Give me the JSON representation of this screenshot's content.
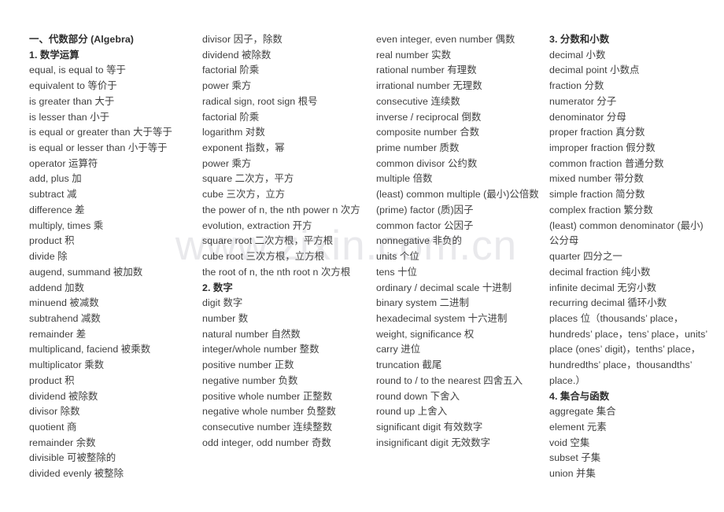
{
  "document": {
    "watermark": "www.zixin.com.cn",
    "background_color": "#ffffff",
    "text_color": "#3f3f3f",
    "watermark_color": "#e9e9ec"
  },
  "columns": [
    {
      "name": "column-1",
      "entries": [
        {
          "text": "一、代数部分 (Algebra)",
          "heading": true
        },
        {
          "text": "1. 数学运算",
          "heading": true
        },
        {
          "text": "equal, is equal to 等于",
          "heading": false
        },
        {
          "text": "equivalent to 等价于",
          "heading": false
        },
        {
          "text": "is greater than 大于",
          "heading": false
        },
        {
          "text": "is lesser than 小于",
          "heading": false
        },
        {
          "text": "is equal or greater than 大于等于",
          "heading": false
        },
        {
          "text": "is equal or lesser than 小于等于",
          "heading": false
        },
        {
          "text": "operator 运算符",
          "heading": false
        },
        {
          "text": "add, plus 加",
          "heading": false
        },
        {
          "text": "subtract 减",
          "heading": false
        },
        {
          "text": "difference 差",
          "heading": false
        },
        {
          "text": "multiply, times 乘",
          "heading": false
        },
        {
          "text": "product 积",
          "heading": false
        },
        {
          "text": "divide 除",
          "heading": false
        },
        {
          "text": "augend, summand 被加数",
          "heading": false
        },
        {
          "text": "addend 加数",
          "heading": false
        },
        {
          "text": "minuend 被减数",
          "heading": false
        },
        {
          "text": "subtrahend 减数",
          "heading": false
        },
        {
          "text": "remainder 差",
          "heading": false
        },
        {
          "text": "multiplicand, faciend 被乘数",
          "heading": false
        },
        {
          "text": "multiplicator 乘数",
          "heading": false
        },
        {
          "text": "product 积",
          "heading": false
        },
        {
          "text": "dividend 被除数",
          "heading": false
        },
        {
          "text": "divisor 除数",
          "heading": false
        },
        {
          "text": "quotient 商",
          "heading": false
        },
        {
          "text": "remainder 余数",
          "heading": false
        },
        {
          "text": "divisible 可被整除的",
          "heading": false
        },
        {
          "text": "divided evenly 被整除",
          "heading": false
        }
      ]
    },
    {
      "name": "column-2",
      "entries": [
        {
          "text": "divisor 因子，除数",
          "heading": false
        },
        {
          "text": "dividend 被除数",
          "heading": false
        },
        {
          "text": "factorial 阶乘",
          "heading": false
        },
        {
          "text": "power 乘方",
          "heading": false
        },
        {
          "text": "radical sign, root sign 根号",
          "heading": false
        },
        {
          "text": "factorial 阶乘",
          "heading": false
        },
        {
          "text": "logarithm 对数",
          "heading": false
        },
        {
          "text": "exponent 指数，幂",
          "heading": false
        },
        {
          "text": "power 乘方",
          "heading": false
        },
        {
          "text": "square 二次方，平方",
          "heading": false
        },
        {
          "text": "cube 三次方，立方",
          "heading": false
        },
        {
          "text": "the power of n, the nth power n 次方",
          "heading": false
        },
        {
          "text": "evolution, extraction 开方",
          "heading": false
        },
        {
          "text": "square root 二次方根，平方根",
          "heading": false
        },
        {
          "text": "cube root 三次方根，立方根",
          "heading": false
        },
        {
          "text": "the root of n, the nth root n 次方根",
          "heading": false
        },
        {
          "text": "2. 数字",
          "heading": true
        },
        {
          "text": "digit 数字",
          "heading": false
        },
        {
          "text": "number 数",
          "heading": false
        },
        {
          "text": "natural number 自然数",
          "heading": false
        },
        {
          "text": "integer/whole number 整数",
          "heading": false
        },
        {
          "text": "positive number 正数",
          "heading": false
        },
        {
          "text": "negative number 负数",
          "heading": false
        },
        {
          "text": "positive whole number 正整数",
          "heading": false
        },
        {
          "text": "negative whole number 负整数",
          "heading": false
        },
        {
          "text": "consecutive number 连续整数",
          "heading": false
        },
        {
          "text": "odd integer, odd number 奇数",
          "heading": false
        }
      ]
    },
    {
      "name": "column-3",
      "entries": [
        {
          "text": "even integer, even number 偶数",
          "heading": false
        },
        {
          "text": "real number 实数",
          "heading": false
        },
        {
          "text": "rational number 有理数",
          "heading": false
        },
        {
          "text": "irrational number 无理数",
          "heading": false
        },
        {
          "text": "consecutive 连续数",
          "heading": false
        },
        {
          "text": "inverse / reciprocal 倒数",
          "heading": false
        },
        {
          "text": "composite number 合数",
          "heading": false
        },
        {
          "text": "prime number 质数",
          "heading": false
        },
        {
          "text": "common divisor 公约数",
          "heading": false
        },
        {
          "text": "multiple 倍数",
          "heading": false
        },
        {
          "text": "(least) common multiple (最小)公倍数",
          "heading": false
        },
        {
          "text": "(prime) factor (质)因子",
          "heading": false
        },
        {
          "text": "common factor 公因子",
          "heading": false
        },
        {
          "text": "nonnegative 非负的",
          "heading": false
        },
        {
          "text": "units 个位",
          "heading": false
        },
        {
          "text": "tens 十位",
          "heading": false
        },
        {
          "text": "ordinary / decimal scale 十进制",
          "heading": false
        },
        {
          "text": "binary system 二进制",
          "heading": false
        },
        {
          "text": "hexadecimal system 十六进制",
          "heading": false
        },
        {
          "text": "weight, significance 权",
          "heading": false
        },
        {
          "text": "carry 进位",
          "heading": false
        },
        {
          "text": "truncation 截尾",
          "heading": false
        },
        {
          "text": "round to / to the nearest 四舍五入",
          "heading": false
        },
        {
          "text": "round down 下舍入",
          "heading": false
        },
        {
          "text": "round up 上舍入",
          "heading": false
        },
        {
          "text": "significant digit 有效数字",
          "heading": false
        },
        {
          "text": "insignificant digit 无效数字",
          "heading": false
        }
      ]
    },
    {
      "name": "column-4",
      "entries": [
        {
          "text": "3. 分数和小数",
          "heading": true
        },
        {
          "text": "decimal 小数",
          "heading": false
        },
        {
          "text": "decimal point 小数点",
          "heading": false
        },
        {
          "text": "fraction 分数",
          "heading": false
        },
        {
          "text": "numerator 分子",
          "heading": false
        },
        {
          "text": "denominator 分母",
          "heading": false
        },
        {
          "text": "proper fraction 真分数",
          "heading": false
        },
        {
          "text": "improper fraction 假分数",
          "heading": false
        },
        {
          "text": "common fraction 普通分数",
          "heading": false
        },
        {
          "text": "mixed number 带分数",
          "heading": false
        },
        {
          "text": "simple fraction 简分数",
          "heading": false
        },
        {
          "text": "complex fraction 繁分数",
          "heading": false
        },
        {
          "text": "(least) common denominator (最小)公分母",
          "heading": false
        },
        {
          "text": "quarter 四分之一",
          "heading": false
        },
        {
          "text": "decimal fraction 纯小数",
          "heading": false
        },
        {
          "text": "infinite decimal 无穷小数",
          "heading": false
        },
        {
          "text": "recurring decimal 循环小数",
          "heading": false
        },
        {
          "text": "places 位（thousands’ place，hundreds’ place，tens’ place，units’ place (ones’ digit)，tenths’ place，hundredths’ place，thousandths’ place.）",
          "heading": false
        },
        {
          "text": "4. 集合与函数",
          "heading": true
        },
        {
          "text": "aggregate 集合",
          "heading": false
        },
        {
          "text": "element 元素",
          "heading": false
        },
        {
          "text": "void 空集",
          "heading": false
        },
        {
          "text": "subset 子集",
          "heading": false
        },
        {
          "text": "union 并集",
          "heading": false
        }
      ]
    }
  ]
}
